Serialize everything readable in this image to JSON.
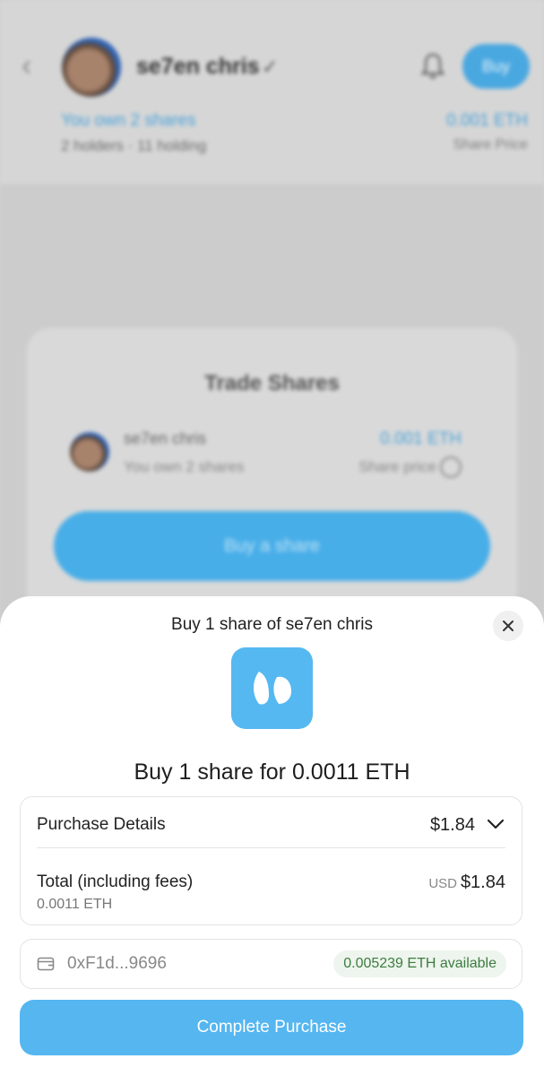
{
  "background": {
    "profile": {
      "name": "se7en chris",
      "owned_text": "You own 2 shares",
      "holders_text": "2 holders · 11 holding",
      "price": "0.001 ETH",
      "price_label": "Share Price",
      "buy_label": "Buy"
    },
    "trade_card": {
      "title": "Trade Shares",
      "name": "se7en chris",
      "owned_text": "You own 2 shares",
      "price": "0.001 ETH",
      "price_label": "Share price",
      "button_label": "Buy a share"
    }
  },
  "sheet": {
    "title": "Buy 1 share of se7en chris",
    "headline": "Buy 1 share for 0.0011 ETH",
    "details": {
      "label": "Purchase Details",
      "amount": "$1.84",
      "total_label": "Total (including fees)",
      "total_eth": "0.0011 ETH",
      "total_currency": "USD",
      "total_amount": "$1.84"
    },
    "wallet": {
      "address": "0xF1d...9696",
      "balance": "0.005239 ETH available"
    },
    "complete_label": "Complete Purchase"
  },
  "colors": {
    "accent": "#55b6f0",
    "balance_text": "#3c7d3f",
    "balance_bg": "#eef4ee"
  },
  "icons": [
    "back-arrow-icon",
    "verified-icon",
    "bell-icon",
    "info-icon",
    "close-icon",
    "app-logo-icon",
    "chevron-down-icon",
    "wallet-icon"
  ]
}
